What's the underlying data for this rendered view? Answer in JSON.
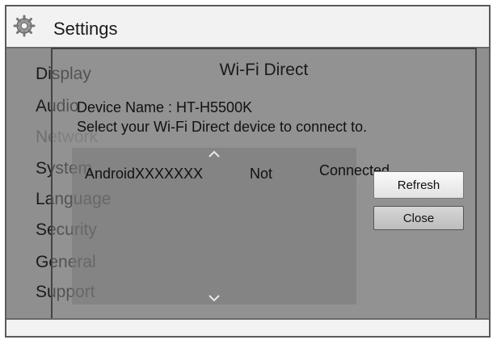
{
  "header": {
    "title": "Settings",
    "icon": "gear-icon"
  },
  "sidebar": {
    "items": [
      {
        "label": "Display",
        "dim": false
      },
      {
        "label": "Audio",
        "dim": false
      },
      {
        "label": "Network",
        "dim": true
      },
      {
        "label": "System",
        "dim": false
      },
      {
        "label": "Language",
        "dim": false
      },
      {
        "label": "Security",
        "dim": false
      },
      {
        "label": "General",
        "dim": false
      },
      {
        "label": "Support",
        "dim": false
      }
    ]
  },
  "dialog": {
    "title": "Wi-Fi Direct",
    "device_name": "Device Name : HT-H5500K",
    "instruction": "Select your Wi-Fi Direct device to connect to.",
    "devices": [
      {
        "name": "AndroidXXXXXXX",
        "status1": "Not",
        "status2": "Connected"
      }
    ],
    "buttons": {
      "refresh": "Refresh",
      "close": "Close"
    }
  }
}
